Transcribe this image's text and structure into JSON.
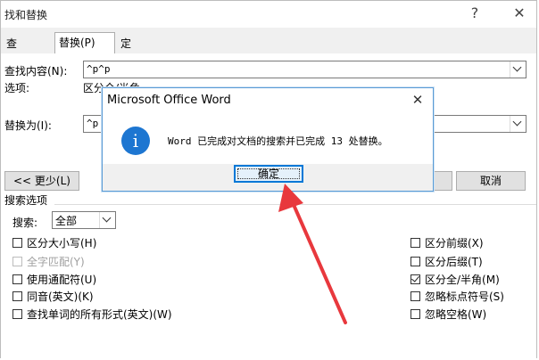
{
  "window": {
    "title": "找和替换",
    "help": "?",
    "close": "✕"
  },
  "tabs": [
    {
      "label": "查找(D)"
    },
    {
      "label": "替换(P)"
    },
    {
      "label": "定位(G)"
    }
  ],
  "find": {
    "label": "查找内容(N):",
    "value": "^p^p",
    "options_label": "选项:",
    "options_value": "区分全/半角"
  },
  "replace": {
    "label": "替换为(I):",
    "value": "^p"
  },
  "buttons": {
    "less": "<< 更少(L)",
    "cancel": "取消"
  },
  "search_options": {
    "title": "搜索选项",
    "search_label": "搜索:",
    "search_value": "全部",
    "left_checks": [
      {
        "label": "区分大小写(H)",
        "checked": false,
        "disabled": false
      },
      {
        "label": "全字匹配(Y)",
        "checked": false,
        "disabled": true
      },
      {
        "label": "使用通配符(U)",
        "checked": false,
        "disabled": false
      },
      {
        "label": "同音(英文)(K)",
        "checked": false,
        "disabled": false
      },
      {
        "label": "查找单词的所有形式(英文)(W)",
        "checked": false,
        "disabled": false
      }
    ],
    "right_checks": [
      {
        "label": "区分前缀(X)",
        "checked": false
      },
      {
        "label": "区分后缀(T)",
        "checked": false
      },
      {
        "label": "区分全/半角(M)",
        "checked": true
      },
      {
        "label": "忽略标点符号(S)",
        "checked": false
      },
      {
        "label": "忽略空格(W)",
        "checked": false
      }
    ]
  },
  "message_box": {
    "title": "Microsoft Office Word",
    "close": "✕",
    "icon": "info-icon",
    "text": "Word 已完成对文档的搜索并已完成 13 处替换。",
    "ok": "确定"
  },
  "colors": {
    "arrow": "#e8383d",
    "info_icon": "#1d76d1",
    "ok_border": "#0078d7"
  }
}
